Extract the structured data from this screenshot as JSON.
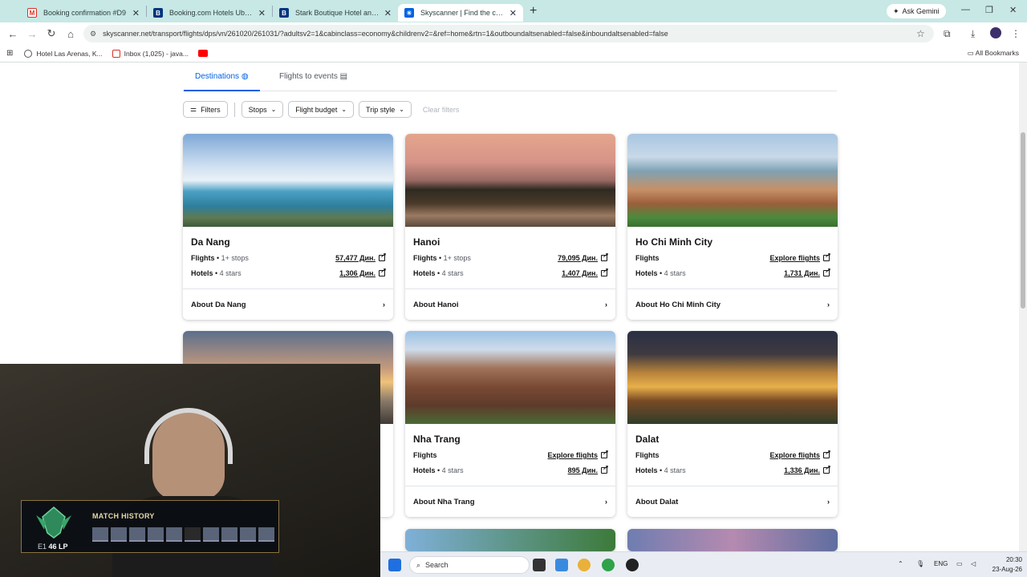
{
  "browser": {
    "tabs": [
      {
        "title": "Booking confirmation #D9",
        "active": false,
        "icon": "gmail-icon"
      },
      {
        "title": "Booking.com Hotels Ubud, Re",
        "active": false,
        "icon": "booking-icon"
      },
      {
        "title": "Stark Boutique Hotel and Spa,",
        "active": false,
        "icon": "booking-icon"
      },
      {
        "title": "Skyscanner | Find the cheapest",
        "active": true,
        "icon": "skyscanner-icon"
      }
    ],
    "ask_gemini": "Ask Gemini",
    "url": "skyscanner.net/transport/flights/dps/vn/261020/261031/?adultsv2=1&cabinclass=economy&childrenv2=&ref=home&rtn=1&outboundaltsenabled=false&inboundaltsenabled=false",
    "bookmarks": [
      {
        "label": "Hotel Las Arenas, K...",
        "icon": "globe-icon"
      },
      {
        "label": "Inbox (1,025) - java...",
        "icon": "gmail-icon"
      },
      {
        "label": "",
        "icon": "youtube-icon"
      }
    ],
    "all_bookmarks": "All Bookmarks"
  },
  "page": {
    "tabs": {
      "destinations": "Destinations",
      "events": "Flights to events"
    },
    "filters": {
      "filters": "Filters",
      "stops": "Stops",
      "budget": "Flight budget",
      "trip_style": "Trip style",
      "clear": "Clear filters"
    },
    "cards": [
      {
        "city": "Da Nang",
        "flights_label": "Flights",
        "flights_detail": "1+ stops",
        "flights_value": "57,477 Дин.",
        "hotels_label": "Hotels",
        "hotels_detail": "4 stars",
        "hotels_value": "1,306 Дин.",
        "about": "About Da Nang"
      },
      {
        "city": "Hanoi",
        "flights_label": "Flights",
        "flights_detail": "1+ stops",
        "flights_value": "79,095 Дин.",
        "hotels_label": "Hotels",
        "hotels_detail": "4 stars",
        "hotels_value": "1,407 Дин.",
        "about": "About Hanoi"
      },
      {
        "city": "Ho Chi Minh City",
        "flights_label": "Flights",
        "flights_detail": "",
        "flights_value": "Explore flights",
        "hotels_label": "Hotels",
        "hotels_detail": "4 stars",
        "hotels_value": "1,731 Дин.",
        "about": "About Ho Chi Minh City"
      },
      {
        "city": "Nha Trang",
        "flights_label": "Flights",
        "flights_detail": "",
        "flights_value": "Explore flights",
        "hotels_label": "Hotels",
        "hotels_detail": "4 stars",
        "hotels_value": "895 Дин.",
        "about": "About Nha Trang"
      },
      {
        "city": "Dalat",
        "flights_label": "Flights",
        "flights_detail": "",
        "flights_value": "Explore flights",
        "hotels_label": "Hotels",
        "hotels_detail": "4 stars",
        "hotels_value": "1,336 Дин.",
        "about": "About Dalat"
      }
    ]
  },
  "overlay": {
    "match_history": "MATCH HISTORY",
    "rank_tier": "E1",
    "rank_lp": "46 LP"
  },
  "taskbar": {
    "search": "Search",
    "lang": "ENG",
    "time": "20:30",
    "date": "23-Aug-26"
  },
  "colors": {
    "accent": "#0062e3",
    "tabbar": "#c7e8e5"
  }
}
